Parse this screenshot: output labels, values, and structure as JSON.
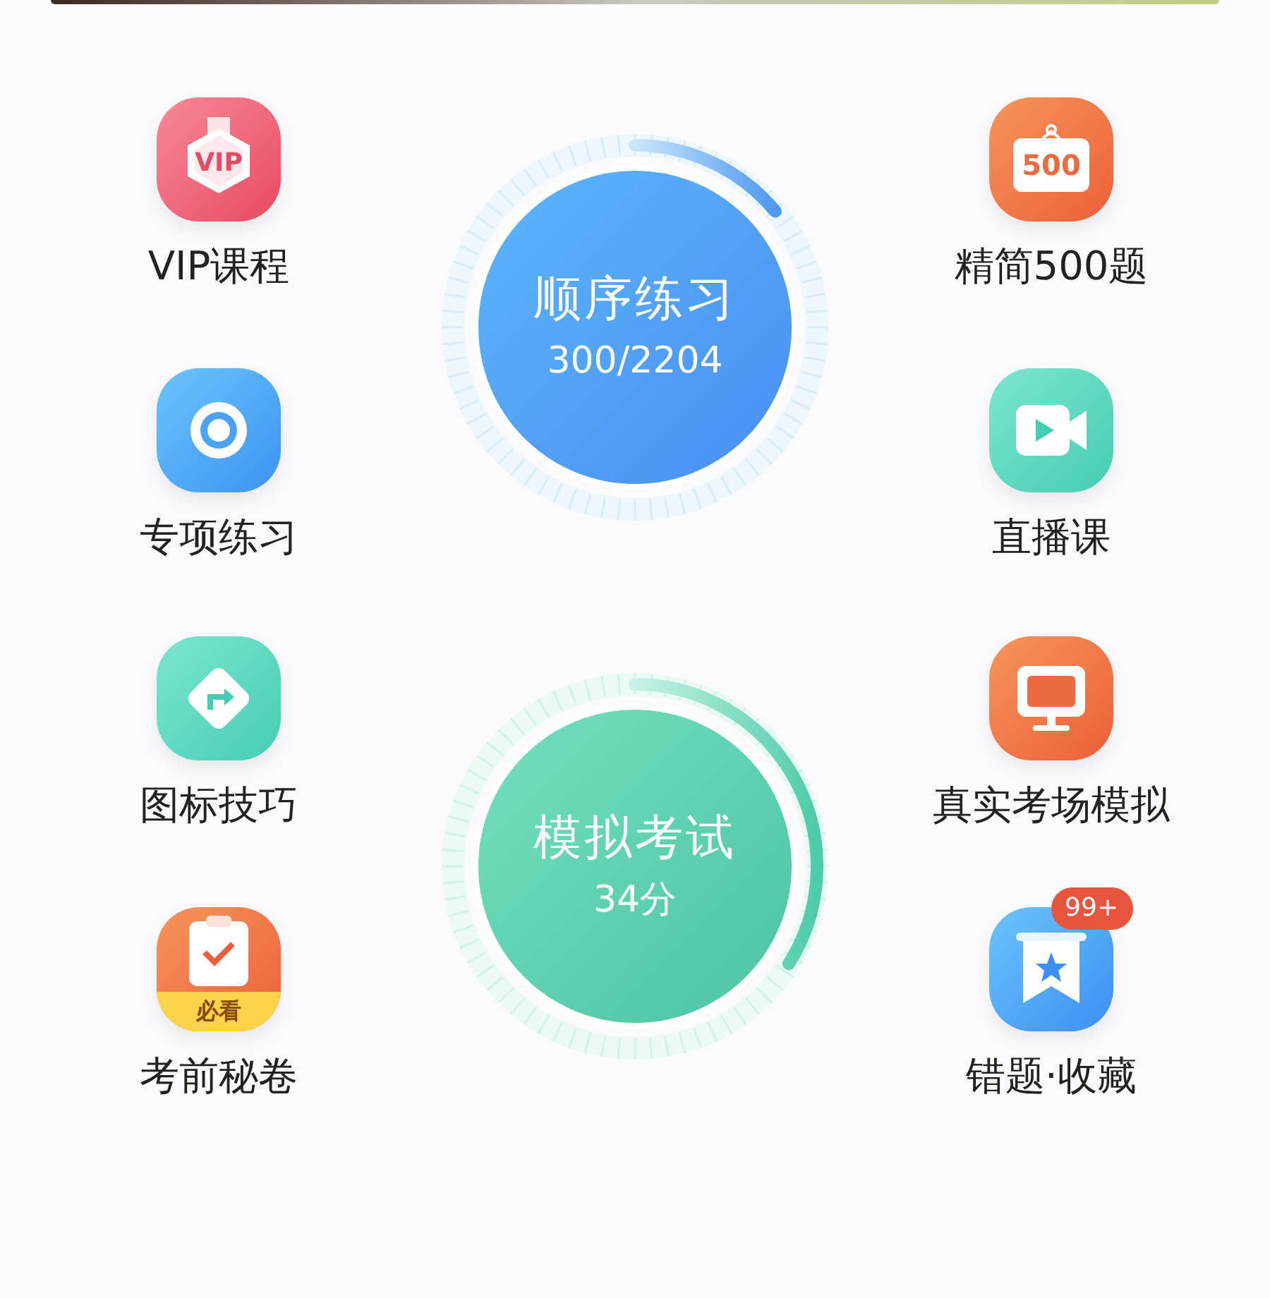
{
  "sections": [
    {
      "ring": {
        "title": "顺序练习",
        "value": "300/2204"
      },
      "left": [
        {
          "label": "VIP课程",
          "kind": "vip",
          "icon_text": "VIP"
        },
        {
          "label": "专项练习",
          "kind": "target"
        }
      ],
      "right": [
        {
          "label": "精简500题",
          "kind": "board",
          "icon_text": "500"
        },
        {
          "label": "直播课",
          "kind": "video"
        }
      ]
    },
    {
      "ring": {
        "title": "模拟考试",
        "value": "34分"
      },
      "left": [
        {
          "label": "图标技巧",
          "kind": "sign"
        },
        {
          "label": "考前秘卷",
          "kind": "checklist",
          "icon_text": "必看"
        }
      ],
      "right": [
        {
          "label": "真实考场模拟",
          "kind": "monitor"
        },
        {
          "label": "错题·收藏",
          "kind": "bookmark",
          "badge": "99+"
        }
      ]
    }
  ]
}
